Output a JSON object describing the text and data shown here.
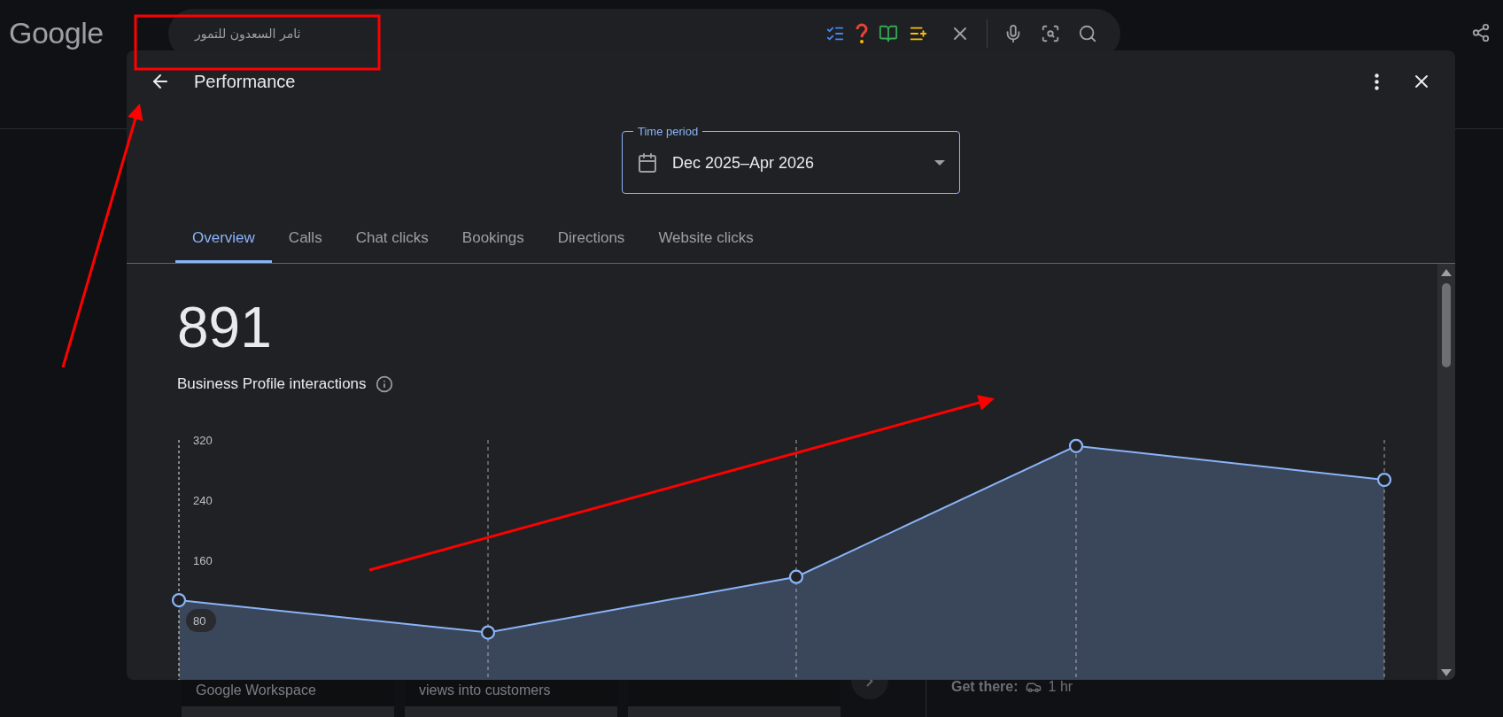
{
  "logo": "Google",
  "search": {
    "value": "ثامر السعدون للتمور"
  },
  "background": {
    "cards": [
      "Google Workspace",
      "views into customers"
    ],
    "get_there": {
      "label": "Get there:",
      "value": "1 hr"
    }
  },
  "dialog": {
    "title": "Performance",
    "time_period": {
      "label": "Time period",
      "value": "Dec 2025–Apr 2026"
    },
    "tabs": [
      {
        "label": "Overview",
        "selected": true
      },
      {
        "label": "Calls",
        "selected": false
      },
      {
        "label": "Chat clicks",
        "selected": false
      },
      {
        "label": "Bookings",
        "selected": false
      },
      {
        "label": "Directions",
        "selected": false
      },
      {
        "label": "Website clicks",
        "selected": false
      }
    ],
    "total": "891",
    "total_label": "Business Profile interactions",
    "chart_data": {
      "type": "area",
      "ylim": [
        0,
        320
      ],
      "yticks": [
        80,
        160,
        240,
        320
      ],
      "series": [
        {
          "color": "#8ab4f8",
          "values": [
            107,
            64,
            138,
            312,
            267
          ]
        }
      ]
    }
  }
}
